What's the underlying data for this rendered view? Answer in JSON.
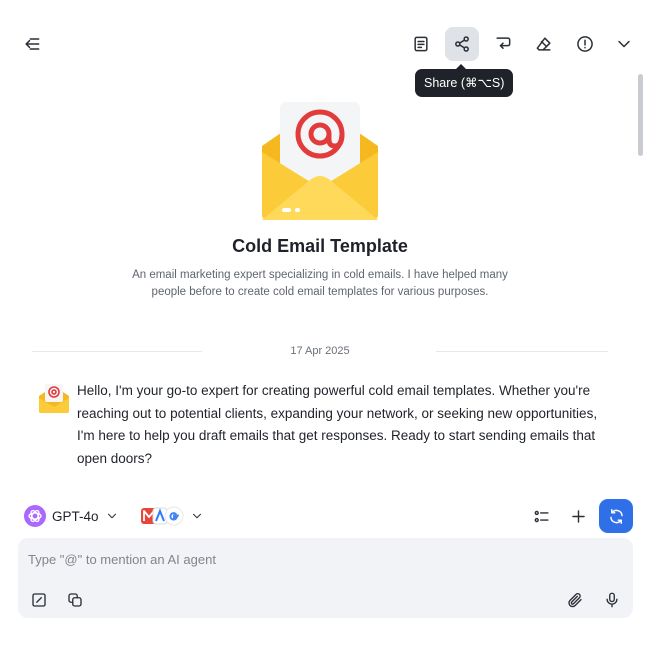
{
  "header": {
    "tooltip": "Share (⌘⌥S)",
    "icons": [
      "back-collapse-icon",
      "notes-icon",
      "share-icon",
      "reply-icon",
      "eraser-icon",
      "info-icon",
      "chevron-down-icon"
    ]
  },
  "agent": {
    "title": "Cold Email Template",
    "description": "An email marketing expert specializing in cold emails. I have helped many people before to create cold email templates for various purposes."
  },
  "conversation": {
    "date": "17 Apr 2025",
    "messages": [
      {
        "role": "assistant",
        "text": "Hello, I'm your go-to expert for creating powerful cold email templates. Whether you're reaching out to potential clients, expanding your network, or seeking new opportunities, I'm here to help you draft emails that get responses. Ready to start sending emails that open doors?"
      }
    ]
  },
  "toolbar": {
    "model_name": "GPT-4o",
    "accent_color": "#2f6fe8"
  },
  "composer": {
    "placeholder": "Type \"@\" to mention an AI agent",
    "value": ""
  }
}
